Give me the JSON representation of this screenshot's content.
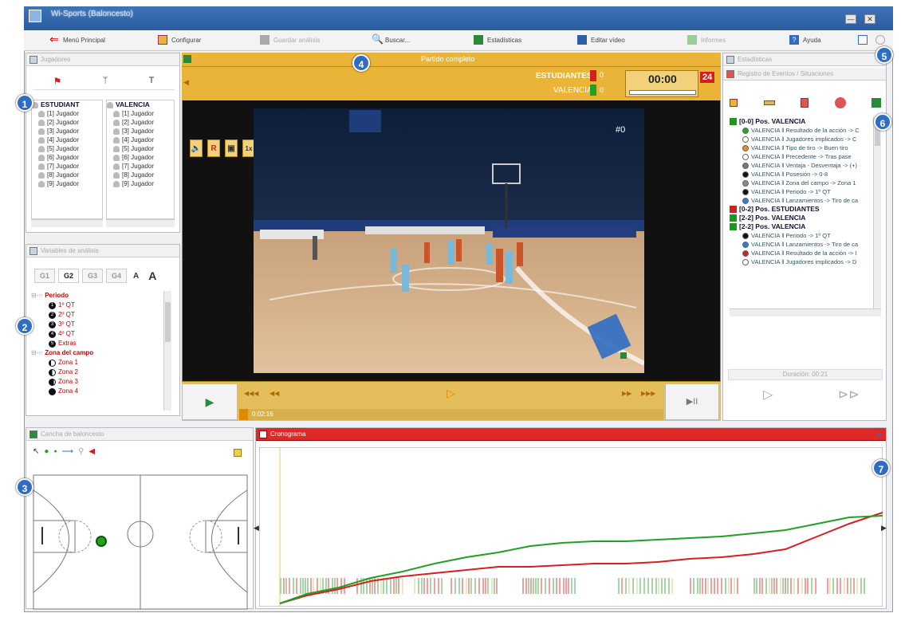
{
  "window": {
    "title": "Wi-Sports (Baloncesto)",
    "min": "—",
    "close": "✕"
  },
  "menu": {
    "main": "Menú Principal",
    "config": "Configurar",
    "save": "Guardar análisis",
    "search": "Buscar...",
    "stats": "Estadísticas",
    "edit_video": "Editar vídeo",
    "reports": "Informes",
    "help": "Ayuda"
  },
  "players_panel": {
    "title": "Jugadores",
    "teams": [
      {
        "name": "ESTUDIANT",
        "players": [
          "[1] Jugador",
          "[2] Jugador",
          "[3] Jugador",
          "[4] Jugador",
          "[5] Jugador",
          "[6] Jugador",
          "[7] Jugador",
          "[8] Jugador",
          "[9] Jugador"
        ]
      },
      {
        "name": "VALENCIA",
        "players": [
          "[1] Jugador",
          "[2] Jugador",
          "[3] Jugador",
          "[4] Jugador",
          "[5] Jugador",
          "[6] Jugador",
          "[7] Jugador",
          "[8] Jugador",
          "[9] Jugador"
        ]
      }
    ]
  },
  "vars_panel": {
    "title": "Variables de análisis",
    "tabs": [
      "G1",
      "G2",
      "G3",
      "G4"
    ],
    "font_small": "A",
    "font_big": "A",
    "groups": [
      {
        "name": "Periodo",
        "items": [
          "1º QT",
          "2º QT",
          "3º QT",
          "4º QT",
          "Extras"
        ],
        "glyphs": [
          "1",
          "2",
          "3",
          "4",
          "5"
        ]
      },
      {
        "name": "Zona del campo",
        "items": [
          "Zona 1",
          "Zona 2",
          "Zona 3",
          "Zona 4"
        ]
      }
    ]
  },
  "video": {
    "title": "Partido completo",
    "team_home": "ESTUDIANTES",
    "team_away": "VALENCIA",
    "score_home": "0",
    "score_away": "0",
    "clock": "00:00",
    "shot_clock": "24",
    "speed": "1x",
    "rec": "R",
    "time": "0:02:16",
    "jersey": "#0",
    "progress": 0.02,
    "transport": {
      "rew_fast": "◀◀◀",
      "rew": "◀◀",
      "fwd": "▶▶",
      "fwd_fast": "▶▶▶",
      "play": "▶",
      "step": "▶II"
    }
  },
  "stats_panel": {
    "title": "Estadísticas",
    "subtitle": "Registro de Eventos / Situaciones",
    "events": [
      {
        "type": "header",
        "text": "[0-0] Pos. VALENCIA",
        "color": "#1a9a1a"
      },
      {
        "type": "item",
        "text": "VALENCIA ‖ Resultado de la acción -> C",
        "color": "#22aa22"
      },
      {
        "type": "item",
        "text": "VALENCIA ‖ Jugadores implicados -> C",
        "color": "#ffffff"
      },
      {
        "type": "item",
        "text": "VALENCIA ‖ Tipo de tiro -> Buen tiro",
        "color": "#e88b2a"
      },
      {
        "type": "item",
        "text": "VALENCIA ‖ Precedente -> Tras pase",
        "color": "#ffffff"
      },
      {
        "type": "item",
        "text": "VALENCIA ‖ Ventaja - Desventaja -> (+)",
        "color": "#777777"
      },
      {
        "type": "item",
        "text": "VALENCIA ‖ Posesión -> 0-8",
        "color": "#111111"
      },
      {
        "type": "item",
        "text": "VALENCIA ‖ Zona del campo -> Zona 1",
        "color": "#888888"
      },
      {
        "type": "item",
        "text": "VALENCIA ‖ Periodo -> 1º QT",
        "color": "#111111"
      },
      {
        "type": "item",
        "text": "VALENCIA ‖ Lanzamientos -> Tiro de ca",
        "color": "#2a7fd0"
      },
      {
        "type": "header",
        "text": "[0-2] Pos. ESTUDIANTES",
        "color": "#d02020"
      },
      {
        "type": "header",
        "text": "[2-2] Pos. VALENCIA",
        "color": "#1a9a1a"
      },
      {
        "type": "header",
        "text": "[2-2] Pos. VALENCIA",
        "color": "#1a9a1a"
      },
      {
        "type": "item",
        "text": "VALENCIA ‖ Periodo -> 1º QT",
        "color": "#111111"
      },
      {
        "type": "item",
        "text": "VALENCIA ‖ Lanzamientos -> Tiro de ca",
        "color": "#2a7fd0"
      },
      {
        "type": "item",
        "text": "VALENCIA ‖ Resultado de la acción -> I",
        "color": "#d02020"
      },
      {
        "type": "item",
        "text": "VALENCIA ‖ Jugadores implicados -> D",
        "color": "#ffffff"
      }
    ],
    "duration": "Duración: 00:21"
  },
  "court_panel": {
    "title": "Cancha de baloncesto"
  },
  "chrono_panel": {
    "title": "Cronograma"
  },
  "badges": [
    "1",
    "2",
    "3",
    "4",
    "5",
    "6",
    "7"
  ],
  "colors": {
    "orange": "#e9b437",
    "red": "#d42020",
    "green": "#22a022",
    "accent": "#2f6dc4"
  }
}
